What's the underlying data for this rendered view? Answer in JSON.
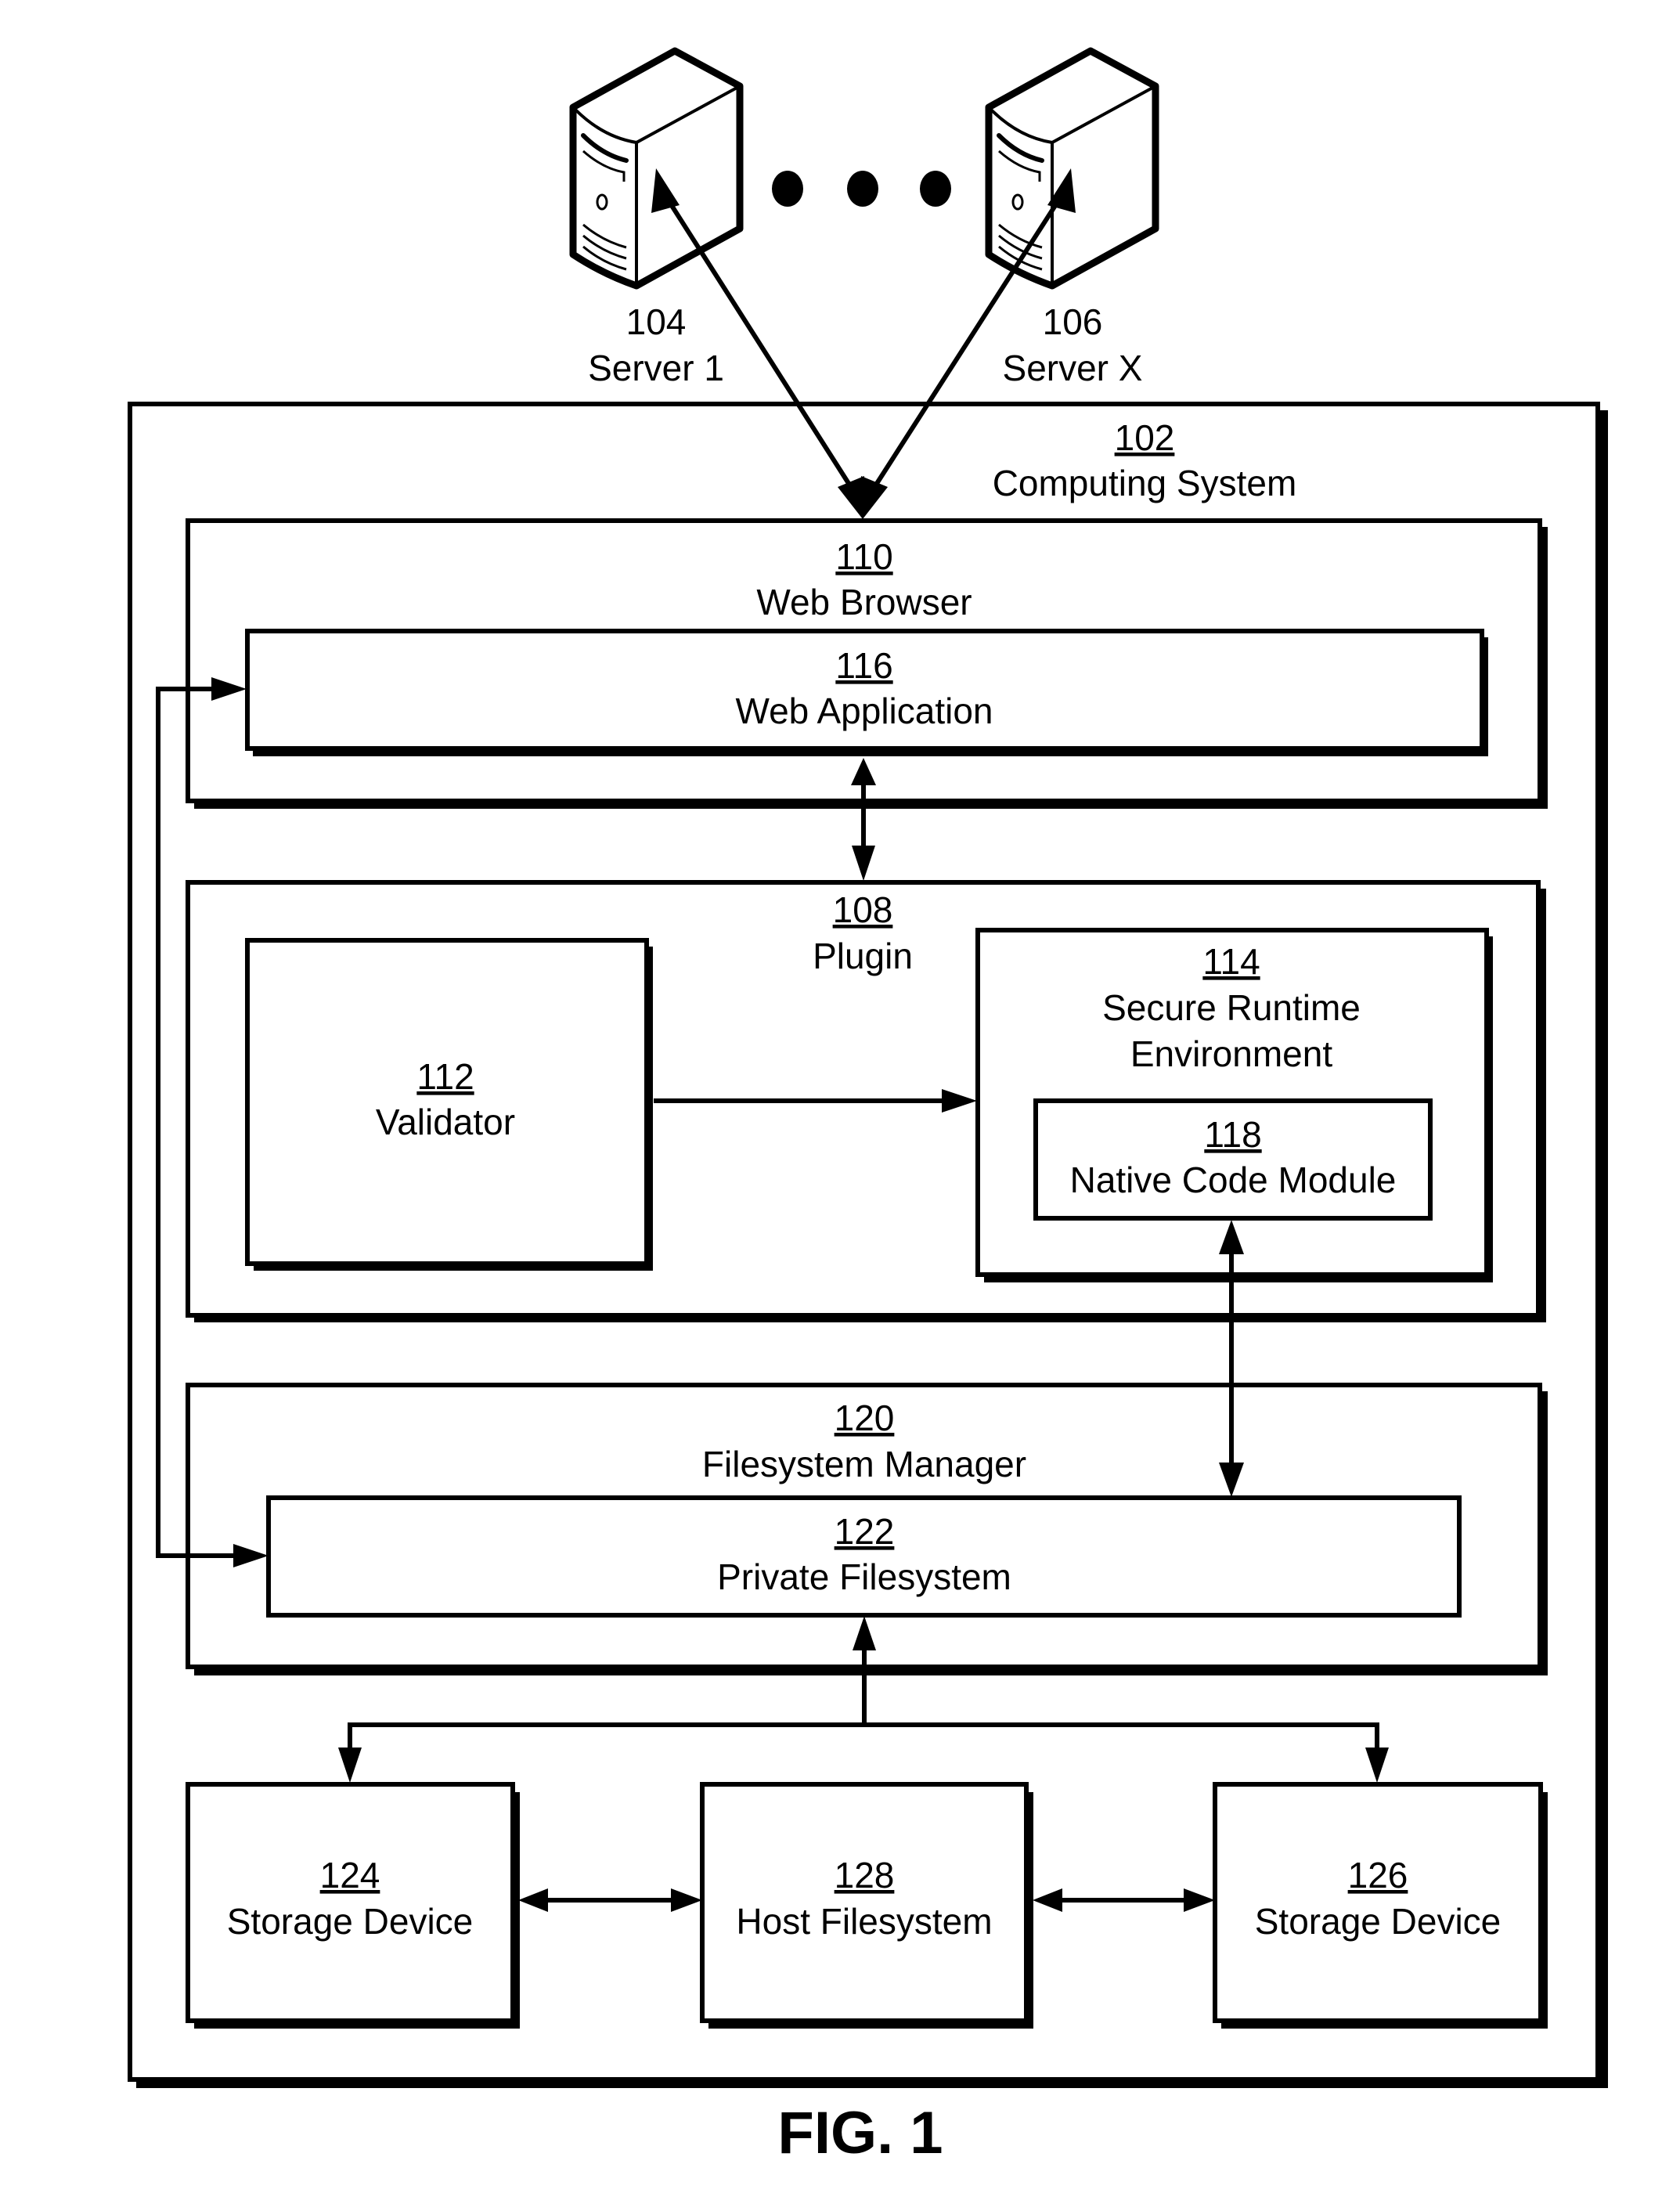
{
  "figure": {
    "caption": "FIG. 1"
  },
  "servers": [
    {
      "id": "104",
      "label": "Server 1"
    },
    {
      "id": "106",
      "label": "Server X"
    }
  ],
  "ellipsis_icon": "three-dots",
  "components": {
    "computing_system": {
      "id": "102",
      "label": "Computing System"
    },
    "web_browser": {
      "id": "110",
      "label": "Web Browser"
    },
    "web_application": {
      "id": "116",
      "label": "Web Application"
    },
    "plugin": {
      "id": "108",
      "label": "Plugin"
    },
    "validator": {
      "id": "112",
      "label": "Validator"
    },
    "secure_runtime": {
      "id": "114",
      "label_line1": "Secure Runtime",
      "label_line2": "Environment"
    },
    "native_code_module": {
      "id": "118",
      "label": "Native Code Module"
    },
    "filesystem_manager": {
      "id": "120",
      "label": "Filesystem Manager"
    },
    "private_filesystem": {
      "id": "122",
      "label": "Private Filesystem"
    },
    "storage_device_1": {
      "id": "124",
      "label": "Storage Device"
    },
    "host_filesystem": {
      "id": "128",
      "label": "Host Filesystem"
    },
    "storage_device_2": {
      "id": "126",
      "label": "Storage Device"
    }
  },
  "connections": [
    {
      "from": "104",
      "to": "110",
      "direction": "bidirectional"
    },
    {
      "from": "106",
      "to": "110",
      "direction": "bidirectional"
    },
    {
      "from": "116",
      "to": "108",
      "direction": "bidirectional"
    },
    {
      "from": "112",
      "to": "114",
      "direction": "forward"
    },
    {
      "from": "118",
      "to": "122",
      "direction": "bidirectional"
    },
    {
      "from": "122",
      "to": "116",
      "direction": "forward"
    },
    {
      "from": "116",
      "to": "122",
      "direction": "forward"
    },
    {
      "from": "122",
      "to": [
        "124",
        "126"
      ],
      "direction": "bidirectional"
    },
    {
      "from": "124",
      "to": "128",
      "direction": "bidirectional"
    },
    {
      "from": "128",
      "to": "126",
      "direction": "bidirectional"
    }
  ]
}
